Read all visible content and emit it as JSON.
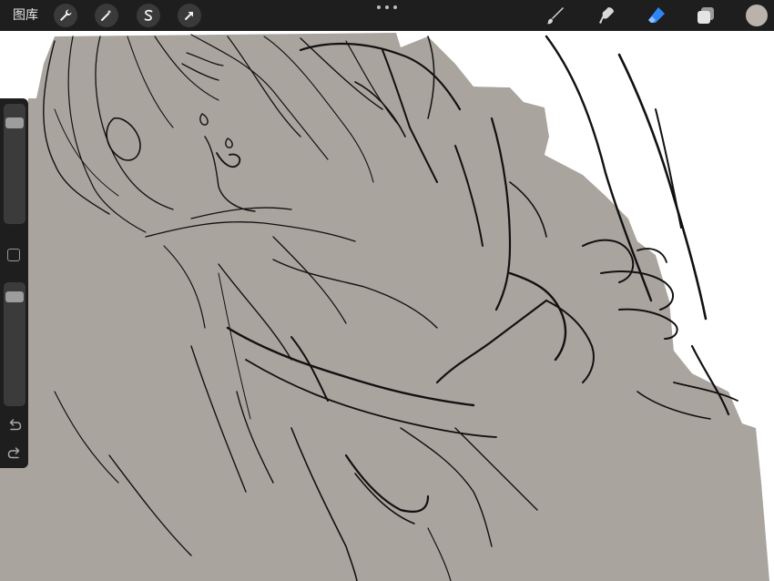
{
  "colors": {
    "toolbar_bg": "#1e1e1e",
    "canvas_bg": "#ffffff",
    "fill_gray": "#aaa49e",
    "eraser_active": "#2e86f5",
    "current_color": "#b9b3ab"
  },
  "toolbar": {
    "gallery_label": "图库",
    "left_icons": [
      "wrench-icon",
      "magic-wand-icon",
      "selection-s-icon",
      "transform-arrow-icon"
    ],
    "right_icons": [
      "brush-icon",
      "smudge-icon",
      "eraser-icon",
      "layers-icon",
      "color-swatch"
    ]
  },
  "sidebar": {
    "brush_size_level": 0.1,
    "opacity_level": 0.05,
    "icons": [
      "modify-square-button",
      "undo-icon",
      "redo-icon"
    ]
  }
}
